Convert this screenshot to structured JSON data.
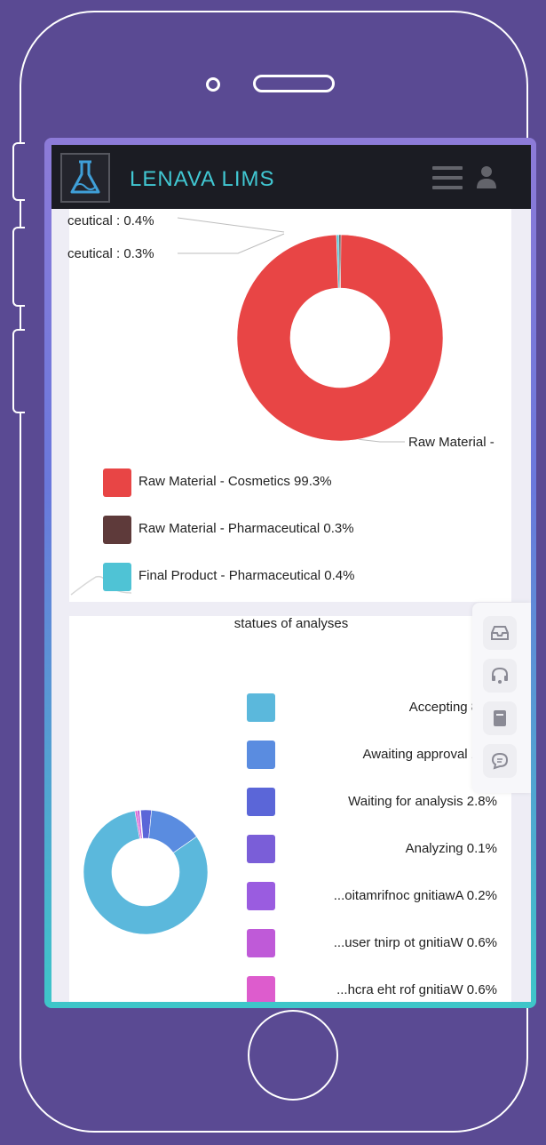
{
  "app": {
    "title": "LENAVA LIMS"
  },
  "icons": {
    "logo": "flask-logo-icon",
    "menu": "hamburger-menu-icon",
    "user": "user-icon",
    "side": [
      "inbox-icon",
      "support-headset-icon",
      "book-icon",
      "chat-icon"
    ]
  },
  "chart_data": [
    {
      "type": "pie",
      "donut": true,
      "callouts": [
        "ceutical : 0.4%",
        "ceutical : 0.3%",
        "Raw Material -"
      ],
      "legend_items": [
        {
          "label": "Raw Material - Cosmetics  99.3%",
          "value": 99.3,
          "color": "#e84545"
        },
        {
          "label": "Raw Material - Pharmaceutical  0.3%",
          "value": 0.3,
          "color": "#5e3a3a"
        },
        {
          "label": "Final Product - Pharmaceutical  0.4%",
          "value": 0.4,
          "color": "#4fc3d5"
        }
      ]
    },
    {
      "type": "pie",
      "donut": true,
      "title": "statues of analyses",
      "legend_items": [
        {
          "label": "Accepting  81.8",
          "value": 81.8,
          "color": "#5bb8dc"
        },
        {
          "label": "Awaiting approval  13.8",
          "value": 13.8,
          "color": "#5a8ce0"
        },
        {
          "label": "Waiting for analysis  2.8%",
          "value": 2.8,
          "color": "#5b66d8"
        },
        {
          "label": "Analyzing  0.1%",
          "value": 0.1,
          "color": "#7a5ed8"
        },
        {
          "label": "...oitamrifnoc gnitiawA  0.2%",
          "value": 0.2,
          "color": "#9a5ce0"
        },
        {
          "label": "...user tnirp ot gnitiaW  0.6%",
          "value": 0.6,
          "color": "#bf5ad8"
        },
        {
          "label": "...hcra eht rof gnitiaW  0.6%",
          "value": 0.6,
          "color": "#dd5ccd"
        }
      ]
    }
  ]
}
